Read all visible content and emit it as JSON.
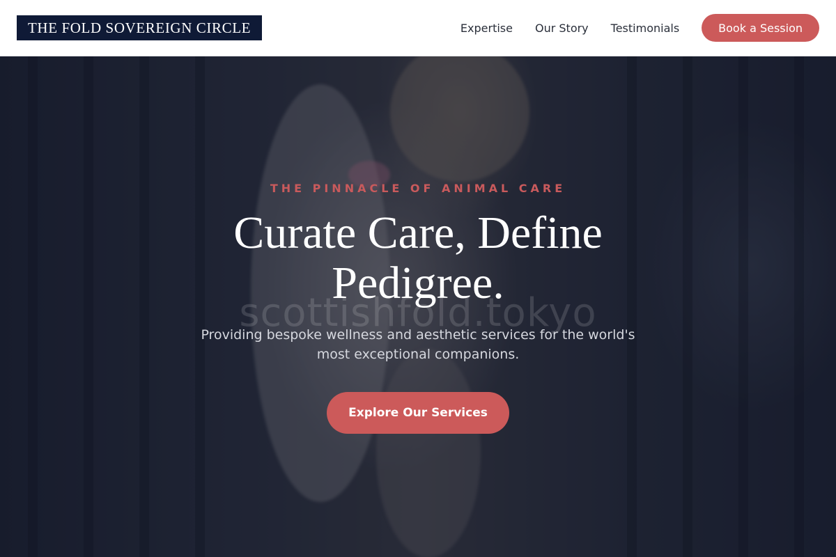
{
  "header": {
    "logo": "THE FOLD SOVEREIGN CIRCLE",
    "nav": [
      "Expertise",
      "Our Story",
      "Testimonials"
    ],
    "cta": "Book a Session"
  },
  "hero": {
    "eyebrow": "THE PINNACLE OF ANIMAL CARE",
    "headline": "Curate Care, Define Pedigree.",
    "subtext": "Providing bespoke wellness and aesthetic services for the world's most exceptional companions.",
    "watermark": "scottishfold.tokyo",
    "cta": "Explore Our Services"
  },
  "colors": {
    "accent": "#cc5a5a",
    "logo_bg": "#0f1a36",
    "hero_overlay": "#1b2031"
  }
}
